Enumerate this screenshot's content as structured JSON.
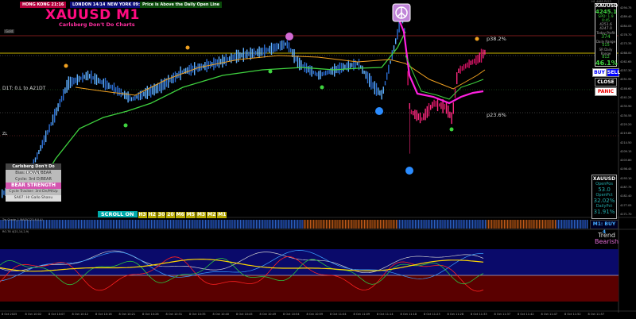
{
  "sessions": [
    {
      "label": "HONG KONG 21:16",
      "color": "#b3003b"
    },
    {
      "label": "LONDON 14/14",
      "color": "#0b0b7a"
    },
    {
      "label": "NEW YORK 09:14",
      "color": "#0b0b7a"
    },
    {
      "label": "Price is Above the Daily Open Line",
      "color": "#0a4a0a"
    }
  ],
  "chart": {
    "symbol_title": "XAUUSD M1",
    "subtitle": "Carlsberg Don't Do Charts",
    "gold_tag": "Gold",
    "level_left_label": "D1T: 0.L to A21DT",
    "level_mid_label": "ZL",
    "fib_upper": "p38.2%",
    "fib_lower": "p23.6%",
    "accent": "#ff0b80"
  },
  "info_panel": {
    "header": "H1 4485 P423",
    "rows": [
      "XAUUSD",
      "4245.1",
      "SPD: 1.9",
      "0:45",
      "4251.6",
      "4247.0",
      "Today Profit",
      "374",
      "Daily Range",
      "515",
      "SR Daily Range",
      "812",
      "46.1%"
    ]
  },
  "buttons": {
    "buy": "BUY",
    "sell": "SELL",
    "close": "CLOSE",
    "panic": "PANIC"
  },
  "info2": {
    "symbol": "XAUUSD",
    "rows": [
      "OpenPos",
      "53.0",
      "OpenPct",
      "32.02%",
      "DailyPct",
      "31.91%"
    ]
  },
  "left_panel": {
    "title": "Carlsberg Don't Do Trades",
    "rows": [
      "Bias: DOWN/BEAR",
      "Cycle: 3rd D/BEAR",
      "BEAR STRENGTH",
      "Cycle Tracker: 3rd Dn/M/Up",
      "SA07: Hr Gallo Shanu"
    ]
  },
  "scroll": {
    "label": "SCROLL ON",
    "timeframes": [
      "H3",
      "H2",
      "30",
      "20",
      "M6",
      "M5",
      "M3",
      "M2",
      "M1"
    ]
  },
  "m1_status": "M1: BUY 4",
  "trend": {
    "label": "Trend",
    "value": "Bearish"
  },
  "indicator_labels": {
    "stripe": "Trn Grade_1 MAGIC(23,6,0,4)",
    "osc": "RO.78 4(21,14,2,9)"
  },
  "y_axis": [
    "4294.75",
    "4289.40",
    "4284.05",
    "4278.70",
    "4273.35",
    "4268.00",
    "4262.65",
    "4257.30",
    "4251.95",
    "4246.60",
    "4241.25",
    "4235.90",
    "4230.55",
    "4225.20",
    "4219.85",
    "4214.50",
    "4209.15",
    "4203.80",
    "4198.45",
    "4193.10",
    "4187.75",
    "4182.40",
    "4177.05",
    "4171.70"
  ],
  "x_axis": [
    "8 Oct 2025",
    "8 Oct 10:02",
    "8 Oct 10:07",
    "8 Oct 10:12",
    "8 Oct 10:16",
    "8 Oct 10:21",
    "8 Oct 10:26",
    "8 Oct 10:31",
    "8 Oct 10:35",
    "8 Oct 10:40",
    "8 Oct 10:45",
    "8 Oct 10:49",
    "8 Oct 10:54",
    "8 Oct 10:59",
    "8 Oct 11:04",
    "8 Oct 11:09",
    "8 Oct 11:14",
    "8 Oct 11:18",
    "8 Oct 11:23",
    "8 Oct 11:28",
    "8 Oct 11:33",
    "8 Oct 11:37",
    "8 Oct 11:42",
    "8 Oct 11:47",
    "8 Oct 11:52",
    "8 Oct 11:57"
  ]
}
